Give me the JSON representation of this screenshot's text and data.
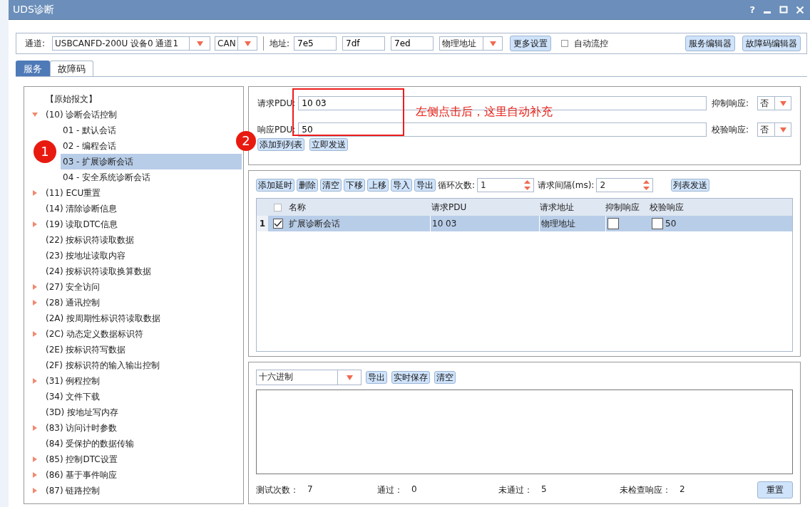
{
  "window": {
    "title": "UDS诊断",
    "help": "?"
  },
  "toolbar": {
    "channel_label": "通道:",
    "channel": "USBCANFD-200U 设备0 通道1",
    "protocol": "CAN",
    "address_label": "地址:",
    "addresses": [
      "7e5",
      "7df",
      "7ed"
    ],
    "address_type": "物理地址",
    "more_settings": "更多设置",
    "auto_flow": {
      "label": "自动流控",
      "checked": false
    },
    "buttons": [
      "服务编辑器",
      "故障码编辑器"
    ]
  },
  "tabs": [
    {
      "label": "服务",
      "selected": true
    },
    {
      "label": "故障码",
      "selected": false
    }
  ],
  "tree": [
    {
      "label": "【原始报文】",
      "kind": "leaf",
      "selected": false
    },
    {
      "label": "(10) 诊断会话控制",
      "kind": "group",
      "expanded": true,
      "selected": false,
      "children": [
        {
          "label": "01 - 默认会话",
          "selected": false
        },
        {
          "label": "02 - 编程会话",
          "selected": false
        },
        {
          "label": "03 - 扩展诊断会话",
          "selected": true
        },
        {
          "label": "04 - 安全系统诊断会话",
          "selected": false
        }
      ]
    },
    {
      "label": "(11) ECU重置",
      "kind": "group",
      "expanded": false,
      "selected": false
    },
    {
      "label": "(14) 清除诊断信息",
      "kind": "leaf",
      "selected": false
    },
    {
      "label": "(19) 读取DTC信息",
      "kind": "group",
      "expanded": false,
      "selected": false
    },
    {
      "label": "(22) 按标识符读取数据",
      "kind": "leaf",
      "selected": false
    },
    {
      "label": "(23) 按地址读取内容",
      "kind": "leaf",
      "selected": false
    },
    {
      "label": "(24) 按标识符读取换算数据",
      "kind": "leaf",
      "selected": false
    },
    {
      "label": "(27) 安全访问",
      "kind": "group",
      "expanded": false,
      "selected": false
    },
    {
      "label": "(28) 通讯控制",
      "kind": "group",
      "expanded": false,
      "selected": false
    },
    {
      "label": "(2A) 按周期性标识符读取数据",
      "kind": "leaf",
      "selected": false
    },
    {
      "label": "(2C) 动态定义数据标识符",
      "kind": "group",
      "expanded": false,
      "selected": false
    },
    {
      "label": "(2E) 按标识符写数据",
      "kind": "leaf",
      "selected": false
    },
    {
      "label": "(2F) 按标识符的输入输出控制",
      "kind": "leaf",
      "selected": false
    },
    {
      "label": "(31) 例程控制",
      "kind": "group",
      "expanded": false,
      "selected": false
    },
    {
      "label": "(34) 文件下载",
      "kind": "leaf",
      "selected": false
    },
    {
      "label": "(3D) 按地址写内存",
      "kind": "leaf",
      "selected": false
    },
    {
      "label": "(83) 访问计时参数",
      "kind": "group",
      "expanded": false,
      "selected": false
    },
    {
      "label": "(84) 受保护的数据传输",
      "kind": "leaf",
      "selected": false
    },
    {
      "label": "(85) 控制DTC设置",
      "kind": "group",
      "expanded": false,
      "selected": false
    },
    {
      "label": "(86) 基于事件响应",
      "kind": "group",
      "expanded": false,
      "selected": false
    },
    {
      "label": "(87) 链路控制",
      "kind": "group",
      "expanded": false,
      "selected": false
    }
  ],
  "request": {
    "request_pdu": {
      "label": "请求PDU:",
      "value": "10 03"
    },
    "suppress": {
      "label": "抑制响应:",
      "value": "否"
    },
    "response_pdu": {
      "label": "响应PDU:",
      "value": "50"
    },
    "verify": {
      "label": "校验响应:",
      "value": "否"
    },
    "buttons": [
      "添加到列表",
      "立即发送"
    ]
  },
  "annotations": {
    "markers": [
      "1",
      "2"
    ],
    "note": "左侧点击后，这里自动补充"
  },
  "list": {
    "buttons": [
      "添加延时",
      "删除",
      "清空",
      "下移",
      "上移",
      "导入",
      "导出"
    ],
    "loop_count": {
      "label": "循环次数:",
      "value": "1"
    },
    "interval": {
      "label": "请求间隔(ms):",
      "value": "2"
    },
    "send": "列表发送",
    "header_checked": false,
    "columns": [
      "名称",
      "请求PDU",
      "请求地址",
      "抑制响应",
      "校验响应"
    ],
    "rows": [
      {
        "index": "1",
        "checked": true,
        "selected": true,
        "name": "扩展诊断会话",
        "request": "10 03",
        "address": "物理地址",
        "suppress": false,
        "verify": false,
        "verify_value": "50"
      }
    ]
  },
  "log": {
    "format": "十六进制",
    "buttons": [
      "导出",
      "实时保存",
      "清空"
    ],
    "stats": [
      {
        "label": "测试次数：",
        "value": "7"
      },
      {
        "label": "通过：",
        "value": "0"
      },
      {
        "label": "未通过：",
        "value": "5"
      },
      {
        "label": "未检查响应：",
        "value": "2"
      }
    ],
    "reset": "重置"
  }
}
